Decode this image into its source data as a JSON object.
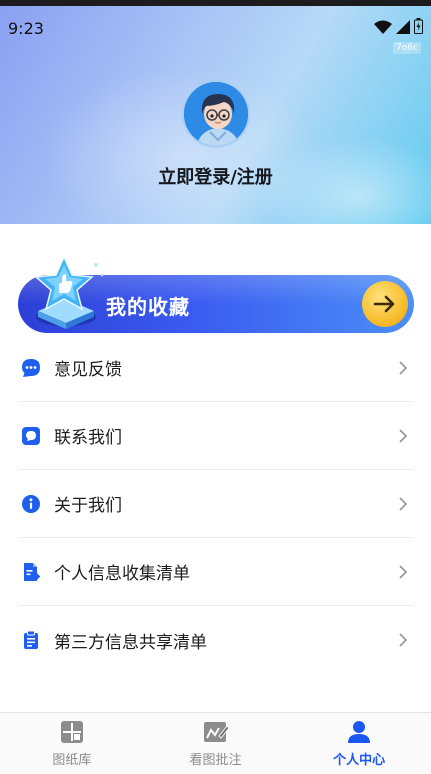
{
  "status_bar": {
    "time": "9:23",
    "tag": "7o6c"
  },
  "profile": {
    "login_text": "立即登录/注册"
  },
  "favorites": {
    "label": "我的收藏"
  },
  "menu": [
    {
      "label": "意见反馈",
      "icon": "chat-bubble-icon"
    },
    {
      "label": "联系我们",
      "icon": "message-icon"
    },
    {
      "label": "关于我们",
      "icon": "info-icon"
    },
    {
      "label": "个人信息收集清单",
      "icon": "document-export-icon"
    },
    {
      "label": "第三方信息共享清单",
      "icon": "clipboard-icon"
    }
  ],
  "tabs": [
    {
      "label": "图纸库",
      "icon": "blueprint-icon",
      "active": false
    },
    {
      "label": "看图批注",
      "icon": "annotate-icon",
      "active": false
    },
    {
      "label": "个人中心",
      "icon": "person-icon",
      "active": true
    }
  ],
  "colors": {
    "accent": "#1a56f0",
    "banner_start": "#2c3fd7",
    "banner_end": "#4b8ff7",
    "icon_blue": "#1f5ff0"
  }
}
